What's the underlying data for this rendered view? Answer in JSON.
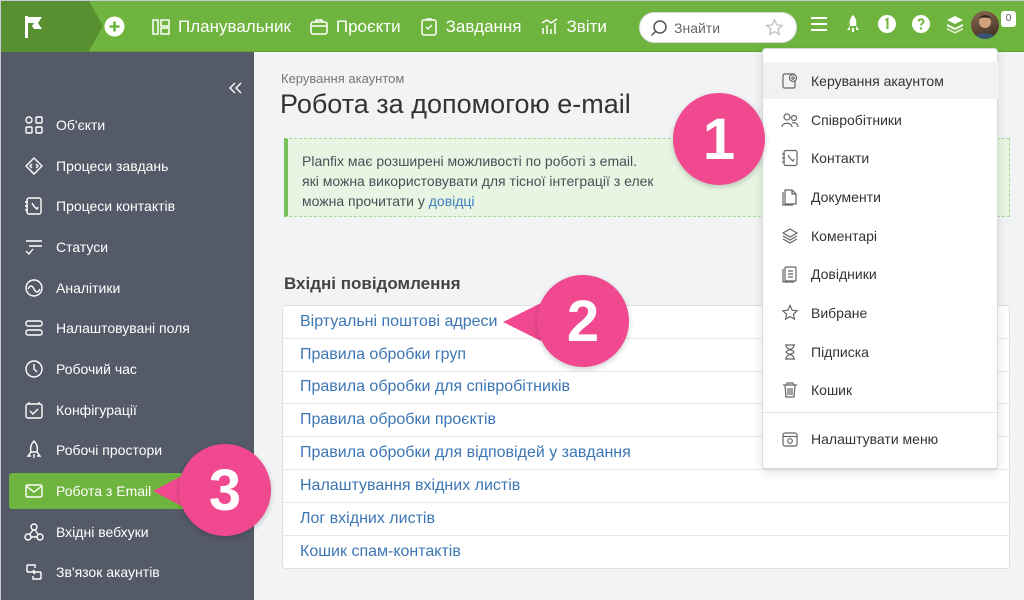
{
  "topbar": {
    "nav": [
      {
        "label": "Планувальник",
        "icon": "planner-icon"
      },
      {
        "label": "Проєкти",
        "icon": "projects-icon"
      },
      {
        "label": "Завдання",
        "icon": "tasks-icon"
      },
      {
        "label": "Звіти",
        "icon": "reports-icon"
      }
    ],
    "search_placeholder": "Знайти",
    "avatar_badge": "0",
    "accent": "#6fb43f"
  },
  "sidebar": {
    "items": [
      {
        "label": "Об'єкти",
        "icon": "objects-icon"
      },
      {
        "label": "Процеси завдань",
        "icon": "task-process-icon"
      },
      {
        "label": "Процеси контактів",
        "icon": "contact-process-icon"
      },
      {
        "label": "Статуси",
        "icon": "statuses-icon"
      },
      {
        "label": "Аналітики",
        "icon": "analytics-icon"
      },
      {
        "label": "Налаштовувані поля",
        "icon": "custom-fields-icon"
      },
      {
        "label": "Робочий час",
        "icon": "clock-icon"
      },
      {
        "label": "Конфігурації",
        "icon": "configurations-icon"
      },
      {
        "label": "Робочі простори",
        "icon": "rocket-icon"
      },
      {
        "label": "Робота з Email",
        "icon": "email-icon",
        "active": true
      },
      {
        "label": "Вхідні вебхуки",
        "icon": "webhooks-icon"
      },
      {
        "label": "Зв'язок акаунтів",
        "icon": "link-accounts-icon"
      }
    ]
  },
  "main": {
    "breadcrumb": "Керування акаунтом",
    "title": "Робота за допомогою e-mail",
    "info_line1": "Planfix має розширені можливості по роботі з email. ",
    "info_line2": "які можна використовувати для тісної інтеграції з елек",
    "info_line3": "можна прочитати у ",
    "info_link": "довідці",
    "section_title": "Вхідні повідомлення",
    "links": [
      "Віртуальні поштові адреси",
      "Правила обробки груп",
      "Правила обробки для співробітників",
      "Правила обробки проєктів",
      "Правила обробки для відповідей у завдання",
      "Налаштування вхідних листів",
      "Лог вхідних листів",
      "Кошик спам-контактів"
    ]
  },
  "menu": {
    "items": [
      {
        "label": "Керування акаунтом",
        "icon": "account-settings-icon",
        "highlight": true
      },
      {
        "label": "Співробітники",
        "icon": "employees-icon"
      },
      {
        "label": "Контакти",
        "icon": "contacts-icon"
      },
      {
        "label": "Документи",
        "icon": "documents-icon"
      },
      {
        "label": "Коментарі",
        "icon": "comments-icon"
      },
      {
        "label": "Довідники",
        "icon": "directories-icon"
      },
      {
        "label": "Вибране",
        "icon": "favorites-icon"
      },
      {
        "label": "Підписка",
        "icon": "subscription-icon"
      },
      {
        "label": "Кошик",
        "icon": "trash-icon"
      }
    ],
    "footer": {
      "label": "Налаштувати меню",
      "icon": "customize-menu-icon"
    }
  },
  "callouts": [
    "1",
    "2",
    "3"
  ],
  "callout_color": "#f0498f"
}
